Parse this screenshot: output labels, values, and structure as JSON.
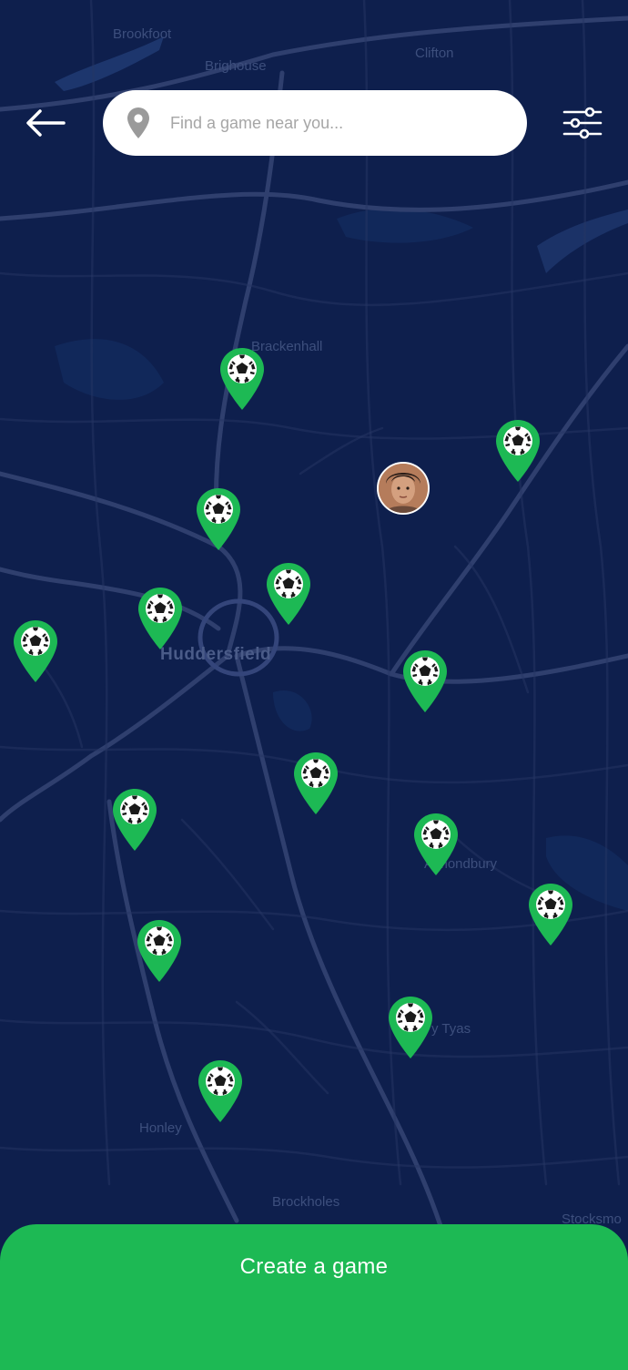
{
  "search": {
    "placeholder": "Find a game near you..."
  },
  "map": {
    "labels": [
      {
        "key": "brookfoot",
        "text": "Brookfoot"
      },
      {
        "key": "brighouse",
        "text": "Brighouse"
      },
      {
        "key": "clifton",
        "text": "Clifton"
      },
      {
        "key": "bradley",
        "text": "Brackenhall"
      },
      {
        "key": "huddersfield",
        "text": "Huddersfield"
      },
      {
        "key": "almondbury",
        "text": "Almondbury"
      },
      {
        "key": "tyas",
        "text": "y Tyas"
      },
      {
        "key": "honley",
        "text": "Honley"
      },
      {
        "key": "brockholes",
        "text": "Brockholes"
      },
      {
        "key": "stocksmoor",
        "text": "Stocksmo"
      }
    ],
    "game_marker_icon": "soccer-ball-pin-icon",
    "game_marker_count": 15,
    "user_avatar_icon": "user-avatar"
  },
  "colors": {
    "map_background": "#0e1f4d",
    "road": "#2e3d6b",
    "accent_green": "#1db954",
    "search_bg": "#ffffff"
  },
  "create_button": {
    "label": "Create a game"
  },
  "icons": {
    "back": "back-arrow-icon",
    "filter": "filter-sliders-icon",
    "location": "location-pin-icon"
  }
}
